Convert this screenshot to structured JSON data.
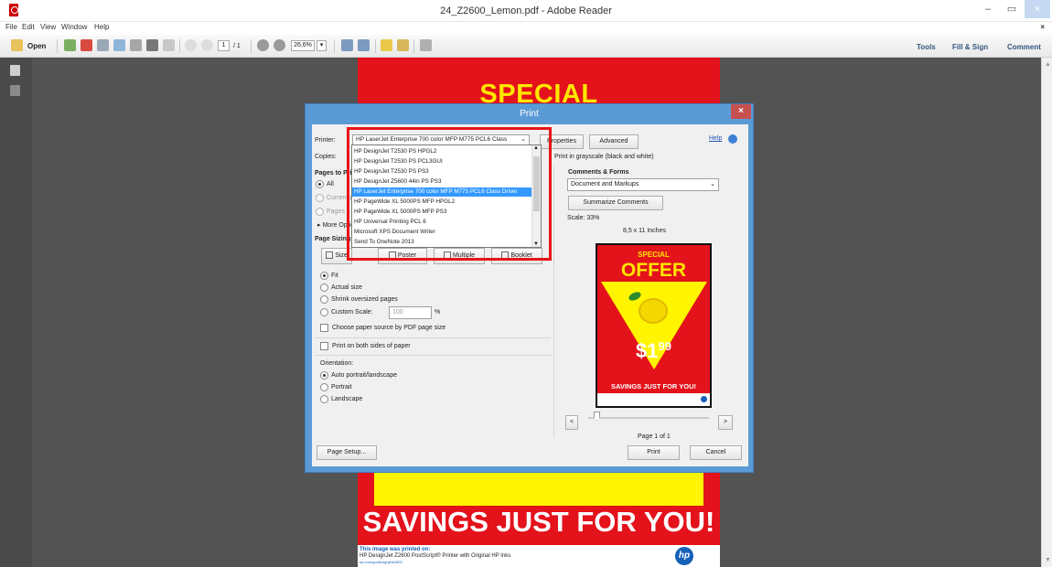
{
  "window": {
    "title": "24_Z2600_Lemon.pdf - Adobe Reader",
    "min": "–",
    "max": "▭",
    "close": "×"
  },
  "menu": {
    "items": [
      "File",
      "Edit",
      "View",
      "Window",
      "Help"
    ],
    "close": "×"
  },
  "toolbar": {
    "open_label": "Open",
    "page_current": "1",
    "page_total": "/ 1",
    "zoom": "26,6%",
    "tools": "Tools",
    "fill_sign": "Fill & Sign",
    "comment": "Comment"
  },
  "document": {
    "headline": "SPECIAL",
    "savings": "SAVINGS JUST FOR YOU!",
    "footer_line1": "This image was printed on:",
    "footer_line2": "HP DesignJet Z2600 PostScript® Printer with Original HP Inks",
    "footer_line3": "hp.com/go/designjetz2600",
    "logo": "hp"
  },
  "print_dialog": {
    "title": "Print",
    "close": "×",
    "printer_label": "Printer:",
    "printer_value": "HP LaserJet Enterprise 700 color MFP M775 PCL6 Class",
    "properties_button": "Properties",
    "advanced_button": "Advanced",
    "help_link": "Help",
    "copies_label": "Copies:",
    "grayscale_label": "Print in grayscale (black and white)",
    "pages_to_print_label": "Pages to Print",
    "radio_all": "All",
    "radio_current": "Current page",
    "radio_pages": "Pages",
    "more_options": "More Options",
    "comments_forms_label": "Comments & Forms",
    "comments_forms_value": "Document and Markups",
    "summarize_button": "Summarize Comments",
    "scale_label": "Scale: 33%",
    "paper_size_label": "8,5 x 11 Inches",
    "page_sizing_label": "Page Sizing & Handling",
    "sizing_buttons": [
      "Size",
      "Poster",
      "Multiple",
      "Booklet"
    ],
    "fit": "Fit",
    "actual_size": "Actual size",
    "shrink": "Shrink oversized pages",
    "custom_scale": "Custom Scale:",
    "custom_scale_value": "100",
    "percent": "%",
    "paper_source": "Choose paper source by PDF page size",
    "both_sides": "Print on both sides of paper",
    "orientation_label": "Orientation:",
    "auto_orientation": "Auto portrait/landscape",
    "portrait": "Portrait",
    "landscape": "Landscape",
    "prev_page": "<",
    "next_page": ">",
    "page_indicator": "Page 1 of 1",
    "page_setup_button": "Page Setup...",
    "print_button": "Print",
    "cancel_button": "Cancel",
    "printer_options": [
      "HP DesignJet T2530 PS HPGL2",
      "HP DesignJet T2530 PS PCL3GUI",
      "HP DesignJet T2530 PS PS3",
      "HP DesignJet Z5600 44in PS PS3",
      "HP LaserJet Enterprise 700 color MFP M775 PCL6 Class Driver",
      "HP PageWide XL 5000PS MFP HPGL2",
      "HP PageWide XL 5000PS MFP PS3",
      "HP Universal Printing PCL 6",
      "Microsoft XPS Document Writer",
      "Send To OneNote 2013"
    ],
    "selected_option_index": 4
  },
  "preview": {
    "special": "SPECIAL",
    "offer": "OFFER",
    "price_dollar": "$1",
    "price_cents": "99",
    "savings": "SAVINGS JUST FOR YOU!"
  },
  "colors": {
    "accent": "#5b9bd5",
    "poster_red": "#e3121b",
    "poster_yellow": "#fff500",
    "highlight": "#e8141b",
    "selection": "#3399ff"
  }
}
